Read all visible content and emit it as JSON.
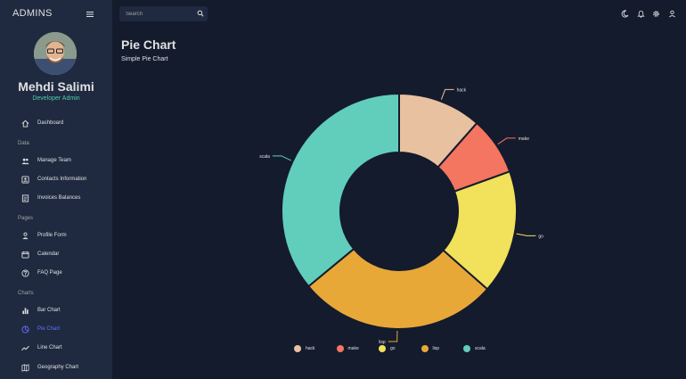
{
  "app": {
    "brand": "ADMINS"
  },
  "profile": {
    "name": "Mehdi Salimi",
    "role": "Developer Admin"
  },
  "sidebar": {
    "sections": {
      "data": "Data",
      "pages": "Pages",
      "charts": "Charts"
    },
    "items": [
      {
        "label": "Dashboard",
        "icon": "home-icon"
      },
      {
        "label": "Manage Team",
        "icon": "people-icon"
      },
      {
        "label": "Contacts Information",
        "icon": "contacts-icon"
      },
      {
        "label": "Invoices Balances",
        "icon": "receipt-icon"
      },
      {
        "label": "Profile Form",
        "icon": "person-icon"
      },
      {
        "label": "Calendar",
        "icon": "calendar-icon"
      },
      {
        "label": "FAQ Page",
        "icon": "help-icon"
      },
      {
        "label": "Bar Chart",
        "icon": "bar-chart-icon"
      },
      {
        "label": "Pie Chart",
        "icon": "pie-chart-icon",
        "active": true
      },
      {
        "label": "Line Chart",
        "icon": "line-chart-icon"
      },
      {
        "label": "Geography Chart",
        "icon": "map-icon"
      }
    ]
  },
  "topbar": {
    "search": {
      "placeholder": "Search",
      "value": ""
    },
    "icons": [
      "dark-mode-icon",
      "notifications-icon",
      "settings-icon",
      "user-icon"
    ]
  },
  "page": {
    "title": "Pie Chart",
    "subtitle": "Simple Pie Chart"
  },
  "colors": {
    "background": "#141b2d",
    "sidebar": "#1f2a40",
    "accent_green": "#4cceac",
    "active": "#6870fa"
  },
  "chart_data": {
    "type": "pie",
    "donut": true,
    "categories": [
      "hack",
      "make",
      "go",
      "lisp",
      "scala"
    ],
    "values": [
      11.5,
      8,
      17,
      27.5,
      36
    ],
    "colors": [
      "#e8c1a0",
      "#f47560",
      "#f1e15b",
      "#e8a838",
      "#61cdbb"
    ],
    "legend_position": "bottom"
  }
}
